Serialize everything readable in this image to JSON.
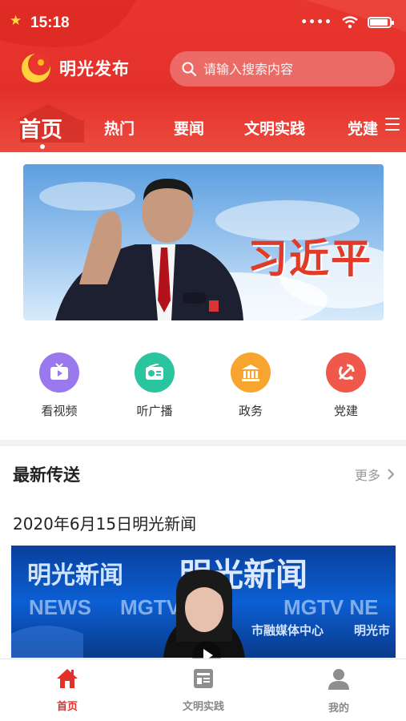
{
  "status_bar": {
    "time": "15:18"
  },
  "header": {
    "app_title": "明光发布",
    "search_placeholder": "请输入搜索内容"
  },
  "tabs": [
    {
      "label": "首页",
      "active": true
    },
    {
      "label": "热门",
      "active": false
    },
    {
      "label": "要闻",
      "active": false
    },
    {
      "label": "文明实践",
      "active": false
    },
    {
      "label": "党建",
      "active": false
    }
  ],
  "banner": {
    "title": "习近平"
  },
  "quick_links": [
    {
      "label": "看视频",
      "icon": "tv-icon",
      "color": "#8f6be9"
    },
    {
      "label": "听广播",
      "icon": "radio-icon",
      "color": "#22c19a"
    },
    {
      "label": "政务",
      "icon": "government-building-icon",
      "color": "#f6a02a"
    },
    {
      "label": "党建",
      "icon": "party-emblem-icon",
      "color": "#ef4a3f"
    }
  ],
  "latest": {
    "section_title": "最新传送",
    "more_label": "更多",
    "news": {
      "title": "2020年6月15日明光新闻",
      "thumb_texts": [
        "明光新闻",
        "明光新闻",
        "NEWS",
        "MGTV",
        "MGTV NE",
        "市融媒体中心",
        "明光市"
      ]
    }
  },
  "bottom_nav": [
    {
      "label": "首页",
      "icon": "home-icon",
      "active": true
    },
    {
      "label": "文明实践",
      "icon": "news-icon",
      "active": false
    },
    {
      "label": "我的",
      "icon": "user-icon",
      "active": false
    }
  ],
  "colors": {
    "brand_red": "#e4302a",
    "active_red": "#e2302b"
  }
}
